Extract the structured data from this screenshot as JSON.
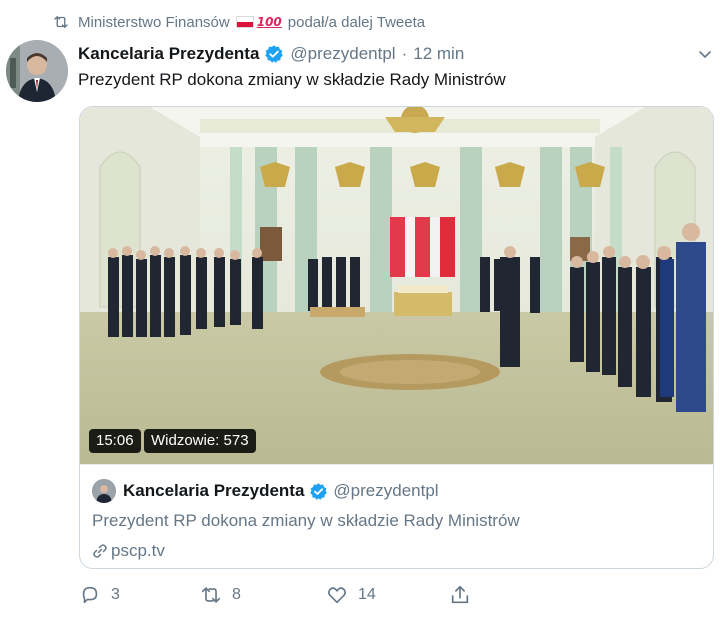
{
  "retweet": {
    "user": "Ministerstwo Finansów",
    "emoji_100": "100",
    "suffix": "podał/a dalej Tweeta"
  },
  "tweet": {
    "author_name": "Kancelaria Prezydenta",
    "handle": "@prezydentpl",
    "separator": "·",
    "time": "12 min",
    "text": "Prezydent RP dokona zmiany w składzie Rady Ministrów"
  },
  "media": {
    "duration": "15:06",
    "viewers": "Widzowie: 573"
  },
  "card": {
    "author_name": "Kancelaria Prezydenta",
    "handle": "@prezydentpl",
    "text": "Prezydent RP dokona zmiany w składzie Rady Ministrów",
    "link": "pscp.tv"
  },
  "actions": {
    "replies": "3",
    "retweets": "8",
    "likes": "14"
  },
  "colors": {
    "verified": "#1da1f2",
    "secondary_text": "#657786",
    "border": "#ccd6dd"
  }
}
